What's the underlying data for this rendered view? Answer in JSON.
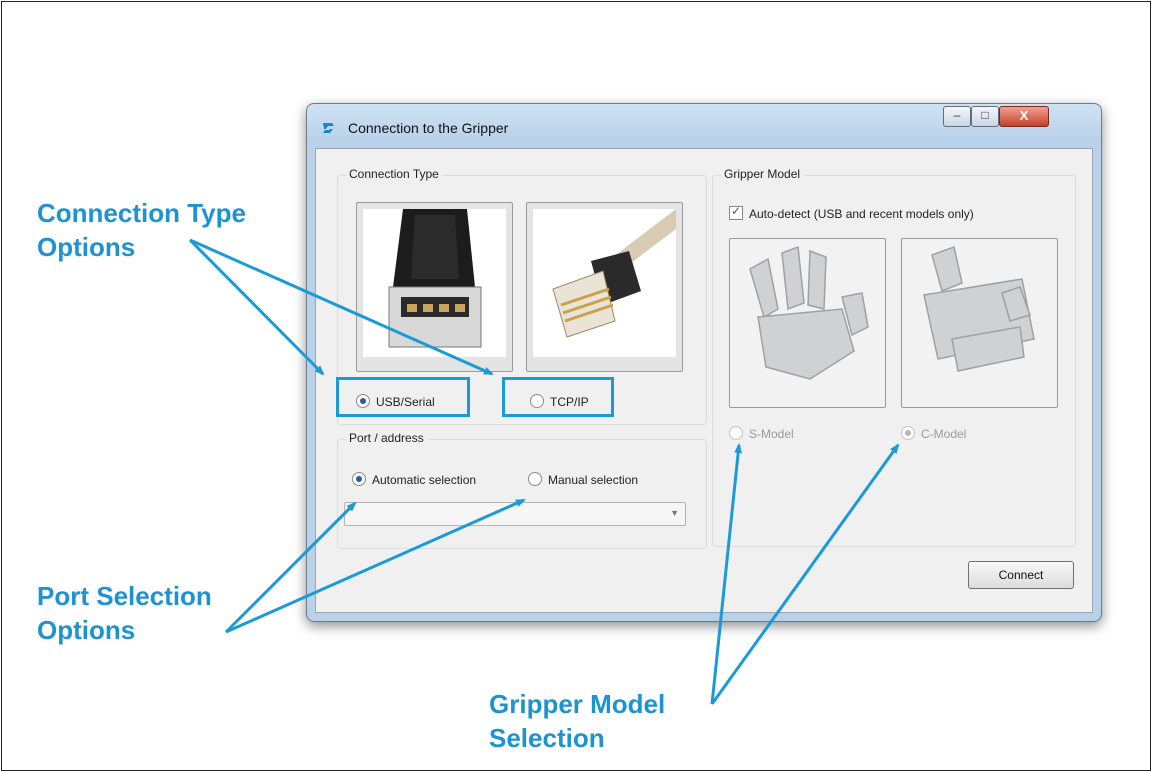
{
  "window": {
    "title": "Connection to the Gripper"
  },
  "title_controls": {
    "minimize": "–",
    "maximize": "□",
    "close": "X"
  },
  "connection_type": {
    "label": "Connection Type",
    "options": [
      {
        "label": "USB/Serial",
        "selected": true
      },
      {
        "label": "TCP/IP",
        "selected": false
      }
    ]
  },
  "port_address": {
    "label": "Port / address",
    "options": [
      {
        "label": "Automatic selection",
        "selected": true
      },
      {
        "label": "Manual selection",
        "selected": false
      }
    ],
    "combo_value": ""
  },
  "gripper_model": {
    "label": "Gripper Model",
    "auto_detect_label": "Auto-detect (USB and recent models only)",
    "auto_detect_checked": true,
    "options": [
      {
        "label": "S-Model",
        "selected": false,
        "disabled": true
      },
      {
        "label": "C-Model",
        "selected": true,
        "disabled": true
      }
    ]
  },
  "connect_button": "Connect",
  "callouts": {
    "connection_type": [
      "Connection Type",
      "Options"
    ],
    "port_selection": [
      "Port Selection",
      "Options"
    ],
    "gripper_model": [
      "Gripper Model",
      "Selection"
    ]
  },
  "colors": {
    "accent": "#1a9ad7",
    "callout_text": "#1d93d2"
  }
}
